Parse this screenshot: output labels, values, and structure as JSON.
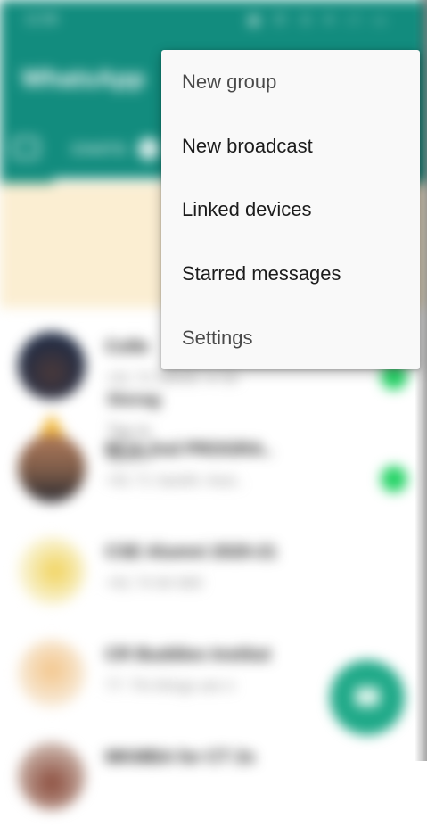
{
  "background": {
    "status_bar": {
      "time": "11:58",
      "icons": "▣ ✆ ⊙ ▾ ıl ▭"
    },
    "header": {
      "title": "WhatsApp"
    },
    "tabs": {
      "chats_label": "CHATS",
      "chats_badge": "6"
    },
    "storage_banner": {
      "title": "Storag",
      "line1": "Tap to",
      "line2": "space"
    },
    "chats": [
      {
        "name": "Colle",
        "preview": "+91 72 56848: ● Sti"
      },
      {
        "name": "BCA 2nd PROGRA..",
        "preview": "+91 71 Santhi: Assi.."
      },
      {
        "name": "CSE Alumni 2020-21",
        "preview": "+91 74 84 900"
      },
      {
        "name": "CR Buddies Institut",
        "preview": "77: Thi things are n"
      },
      {
        "name": "MKMBA for CT 2s",
        "preview": ""
      }
    ]
  },
  "menu": {
    "items": [
      {
        "label": "New group"
      },
      {
        "label": "New broadcast"
      },
      {
        "label": "Linked devices"
      },
      {
        "label": "Starred messages"
      },
      {
        "label": "Settings"
      }
    ]
  },
  "colors": {
    "brand_green": "#128c7e",
    "banner_yellow": "#fbeed2",
    "unread_green": "#25d366",
    "menu_background": "#f9f9f9"
  }
}
